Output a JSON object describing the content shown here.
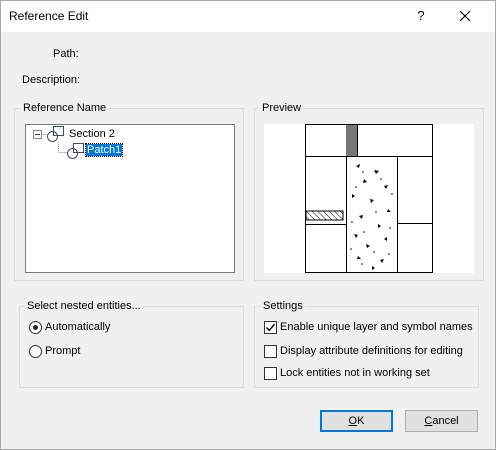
{
  "window": {
    "title": "Reference Edit",
    "help_label": "?",
    "close_icon": "close-icon"
  },
  "info": {
    "path_label": "Path:",
    "description_label": "Description:"
  },
  "reference_name": {
    "group_label": "Reference Name",
    "tree": [
      {
        "label": "Section 2",
        "expanded": true,
        "icon": "block-reference-icon"
      },
      {
        "label": "Patch1",
        "selected": true,
        "icon": "block-reference-icon"
      }
    ]
  },
  "preview": {
    "group_label": "Preview"
  },
  "nested": {
    "group_label": "Select nested entities...",
    "options": [
      {
        "label": "Automatically",
        "selected": true
      },
      {
        "label": "Prompt",
        "selected": false
      }
    ]
  },
  "settings": {
    "group_label": "Settings",
    "options": [
      {
        "label": "Enable unique layer and symbol names",
        "checked": true
      },
      {
        "label": "Display attribute definitions for editing",
        "checked": false
      },
      {
        "label": "Lock entities not in working set",
        "checked": false
      }
    ]
  },
  "buttons": {
    "ok": {
      "mnemonic": "O",
      "rest": "K"
    },
    "cancel": {
      "mnemonic": "C",
      "rest": "ancel"
    }
  },
  "colors": {
    "selection": "#0078d7",
    "dialog_bg": "#f0f0f0"
  }
}
